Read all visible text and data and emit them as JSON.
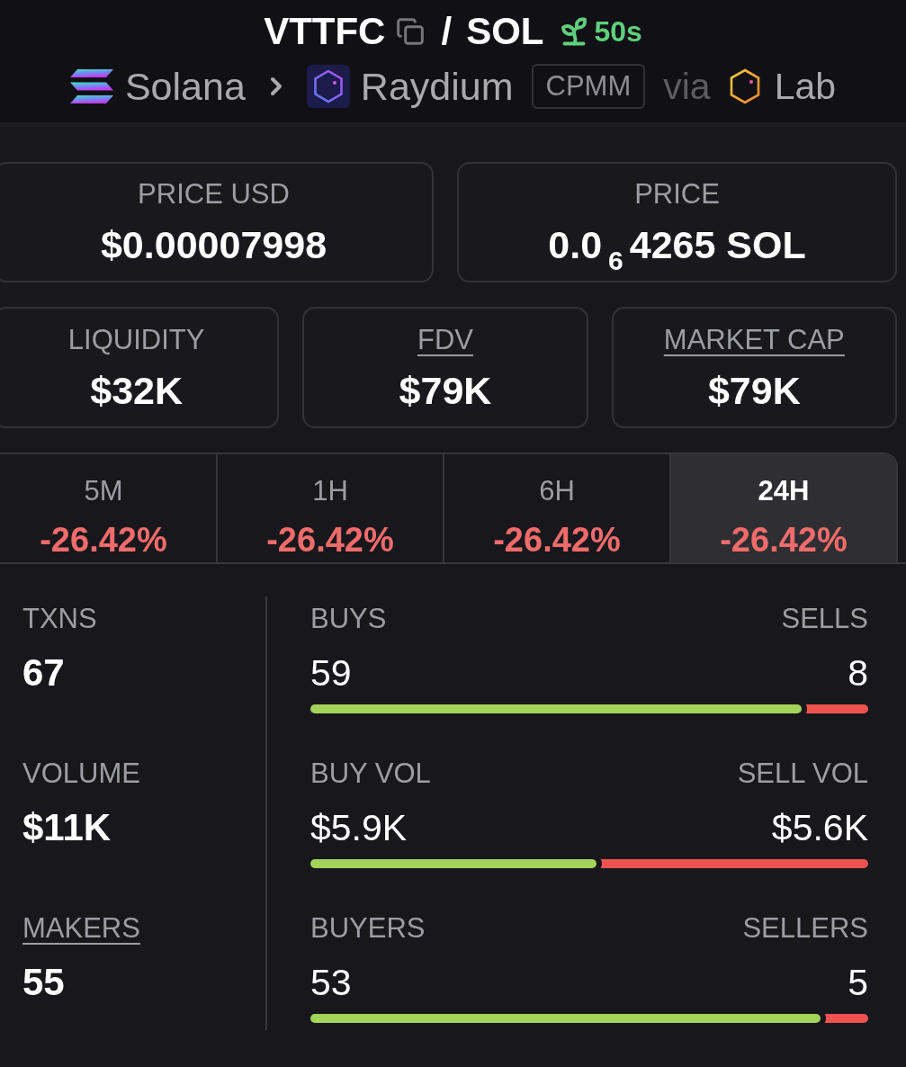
{
  "header": {
    "base_symbol": "VTTFC",
    "separator": "/",
    "quote_symbol": "SOL",
    "age": "50s"
  },
  "breadcrumb": {
    "chain": "Solana",
    "dex": "Raydium",
    "pool_type": "CPMM",
    "via": "via",
    "launchpad": "Lab"
  },
  "price_cards": [
    {
      "label": "PRICE USD",
      "value": "$0.00007998",
      "underlined": false
    },
    {
      "label": "PRICE",
      "value": "0.0$_{6}$4265 SOL",
      "underlined": false
    }
  ],
  "metric_cards": [
    {
      "label": "LIQUIDITY",
      "value": "$32K",
      "underlined": false
    },
    {
      "label": "FDV",
      "value": "$79K",
      "underlined": true
    },
    {
      "label": "MARKET CAP",
      "value": "$79K",
      "underlined": true
    }
  ],
  "timeframes": [
    {
      "label": "5M",
      "change": "-26.42%",
      "selected": false
    },
    {
      "label": "1H",
      "change": "-26.42%",
      "selected": false
    },
    {
      "label": "6H",
      "change": "-26.42%",
      "selected": false
    },
    {
      "label": "24H",
      "change": "-26.42%",
      "selected": true
    }
  ],
  "stats": [
    {
      "label": "TXNS",
      "value": "67",
      "underlined": false,
      "buy_label": "BUYS",
      "buy_value": "59",
      "sell_label": "SELLS",
      "sell_value": "8",
      "level": 0.88
    },
    {
      "label": "VOLUME",
      "value": "$11K",
      "underlined": false,
      "buy_label": "BUY VOL",
      "buy_value": "$5.9K",
      "sell_label": "SELL VOL",
      "sell_value": "$5.6K",
      "level": 0.513
    },
    {
      "label": "MAKERS",
      "value": "55",
      "underlined": true,
      "buy_label": "BUYERS",
      "buy_value": "53",
      "sell_label": "SELLERS",
      "sell_value": "5",
      "level": 0.915
    }
  ]
}
